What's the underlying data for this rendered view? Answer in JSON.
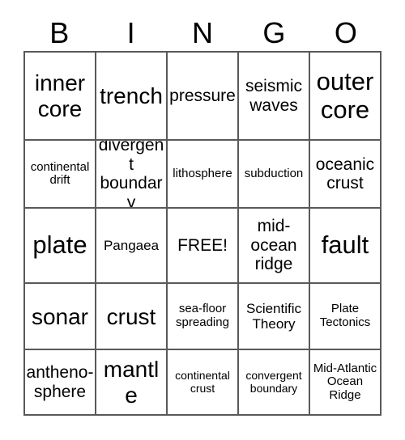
{
  "card": {
    "title_letters": [
      "B",
      "I",
      "N",
      "G",
      "O"
    ],
    "free_space_label": "FREE!",
    "border_color": "#595959",
    "text_color": "#000000",
    "background_color": "#ffffff",
    "rows": [
      [
        {
          "label": "inner core",
          "size": "lg"
        },
        {
          "label": "trench",
          "size": "lg"
        },
        {
          "label": "pressure",
          "size": "md"
        },
        {
          "label": "seismic waves",
          "size": "md"
        },
        {
          "label": "outer core",
          "size": "xl"
        }
      ],
      [
        {
          "label": "continental drift",
          "size": "xs"
        },
        {
          "label": "divergent boundary",
          "size": "md"
        },
        {
          "label": "lithosphere",
          "size": "xs"
        },
        {
          "label": "subduction",
          "size": "xs"
        },
        {
          "label": "oceanic crust",
          "size": "md"
        }
      ],
      [
        {
          "label": "plate",
          "size": "xl"
        },
        {
          "label": "Pangaea",
          "size": "sm"
        },
        {
          "label": "FREE!",
          "size": "md"
        },
        {
          "label": "mid-ocean ridge",
          "size": "md"
        },
        {
          "label": "fault",
          "size": "xl"
        }
      ],
      [
        {
          "label": "sonar",
          "size": "lg"
        },
        {
          "label": "crust",
          "size": "lg"
        },
        {
          "label": "sea-floor spreading",
          "size": "xs"
        },
        {
          "label": "Scientific Theory",
          "size": "sm"
        },
        {
          "label": "Plate Tectonics",
          "size": "xs"
        }
      ],
      [
        {
          "label": "antheno-sphere",
          "size": "md"
        },
        {
          "label": "mantle",
          "size": "lg"
        },
        {
          "label": "continental crust",
          "size": "xxs"
        },
        {
          "label": "convergent boundary",
          "size": "xxs"
        },
        {
          "label": "Mid-Atlantic Ocean Ridge",
          "size": "xs"
        }
      ]
    ]
  }
}
